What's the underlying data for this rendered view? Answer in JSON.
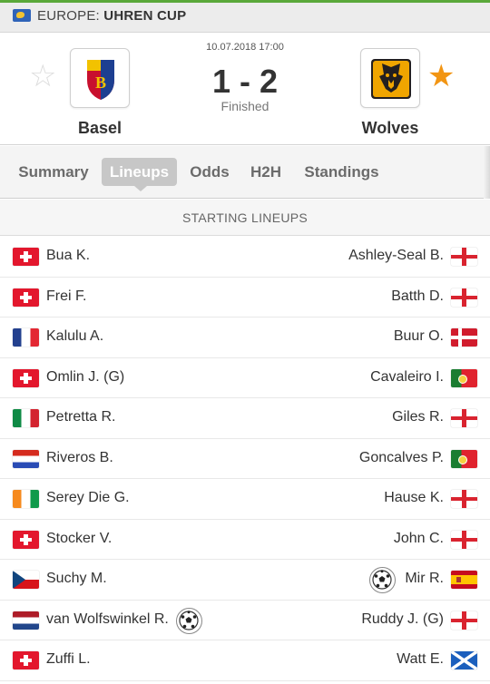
{
  "header": {
    "league_label": "EUROPE:",
    "league_name": "UHREN CUP",
    "league_icon": "globe-icon"
  },
  "match": {
    "datetime": "10.07.2018 17:00",
    "score": "1 - 2",
    "status": "Finished",
    "home": {
      "name": "Basel",
      "favorite": false
    },
    "away": {
      "name": "Wolves",
      "favorite": true
    }
  },
  "tabs": [
    {
      "label": "Summary",
      "active": false
    },
    {
      "label": "Lineups",
      "active": true
    },
    {
      "label": "Odds",
      "active": false
    },
    {
      "label": "H2H",
      "active": false
    },
    {
      "label": "Standings",
      "active": false
    }
  ],
  "section_title": "STARTING LINEUPS",
  "lineups": [
    {
      "home": {
        "name": "Bua K.",
        "flag": "ch"
      },
      "away": {
        "name": "Ashley-Seal B.",
        "flag": "en"
      }
    },
    {
      "home": {
        "name": "Frei F.",
        "flag": "ch"
      },
      "away": {
        "name": "Batth D.",
        "flag": "en"
      }
    },
    {
      "home": {
        "name": "Kalulu A.",
        "flag": "fr"
      },
      "away": {
        "name": "Buur O.",
        "flag": "dk"
      }
    },
    {
      "home": {
        "name": "Omlin J. (G)",
        "flag": "ch"
      },
      "away": {
        "name": "Cavaleiro I.",
        "flag": "pt"
      }
    },
    {
      "home": {
        "name": "Petretta R.",
        "flag": "it"
      },
      "away": {
        "name": "Giles R.",
        "flag": "en"
      }
    },
    {
      "home": {
        "name": "Riveros B.",
        "flag": "py"
      },
      "away": {
        "name": "Goncalves P.",
        "flag": "pt"
      }
    },
    {
      "home": {
        "name": "Serey Die G.",
        "flag": "ci"
      },
      "away": {
        "name": "Hause K.",
        "flag": "en"
      }
    },
    {
      "home": {
        "name": "Stocker V.",
        "flag": "ch"
      },
      "away": {
        "name": "John C.",
        "flag": "en"
      }
    },
    {
      "home": {
        "name": "Suchy M.",
        "flag": "cz"
      },
      "away": {
        "name": "Mir R.",
        "flag": "es",
        "goal": true
      }
    },
    {
      "home": {
        "name": "van Wolfswinkel R.",
        "flag": "nl",
        "goal": true
      },
      "away": {
        "name": "Ruddy J. (G)",
        "flag": "en"
      }
    },
    {
      "home": {
        "name": "Zuffi L.",
        "flag": "ch"
      },
      "away": {
        "name": "Watt E.",
        "flag": "sc"
      }
    }
  ],
  "colors": {
    "accent_green": "#5aa83a",
    "favorite_star": "#f29513",
    "active_tab": "#c7c7c7"
  }
}
